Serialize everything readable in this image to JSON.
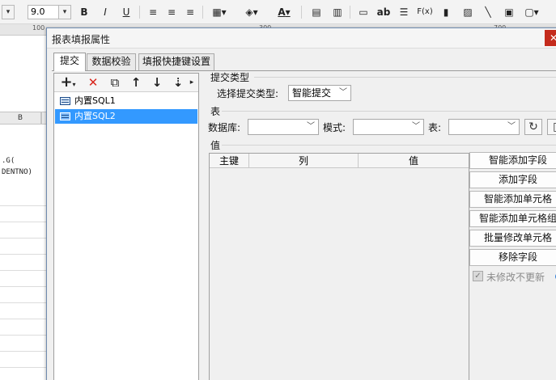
{
  "toolbar": {
    "font_size": "9.0",
    "bold_label": "B",
    "italic_label": "I",
    "underline_label": "U",
    "text_label": "ab",
    "fx_label": "F(x)",
    "font_color_label": "A"
  },
  "ruler": {
    "ticks": [
      "100",
      "300",
      "700"
    ]
  },
  "sheet": {
    "column_b": "B",
    "cell_text_1": ".G(",
    "cell_text_2": "DENTNO)"
  },
  "dialog": {
    "title": "报表填报属性",
    "close_label": "✕",
    "tabs": [
      {
        "label": "提交"
      },
      {
        "label": "数据校验"
      },
      {
        "label": "填报快捷键设置"
      }
    ],
    "list_toolbar": {
      "add": "+",
      "delete": "✕",
      "copy": "⧉",
      "up": "↑",
      "down": "↓",
      "more": "⇣"
    },
    "list_items": [
      {
        "label": "内置SQL1"
      },
      {
        "label": "内置SQL2"
      }
    ],
    "submit_type": {
      "section_title": "提交类型",
      "select_label": "选择提交类型:",
      "selected_value": "智能提交"
    },
    "table_section": {
      "section_title": "表",
      "database_label": "数据库:",
      "database_value": "",
      "schema_label": "模式:",
      "schema_value": "",
      "table_label": "表:",
      "table_value": ""
    },
    "value_section": {
      "section_title": "值",
      "columns": [
        "主键",
        "列",
        "值"
      ]
    },
    "side_buttons": [
      "智能添加字段",
      "添加字段",
      "智能添加单元格",
      "智能添加单元格组",
      "批量修改单元格",
      "移除字段"
    ],
    "unmodified_checkbox": {
      "label": "未修改不更新",
      "checked": true
    }
  }
}
